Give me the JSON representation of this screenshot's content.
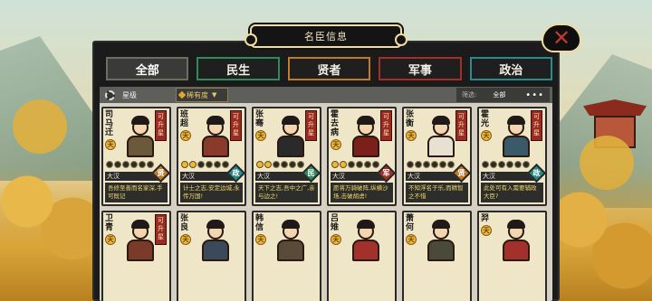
{
  "title": "名臣信息",
  "tabs": [
    "全部",
    "民生",
    "贤者",
    "军事",
    "政治"
  ],
  "filters": {
    "star_label": "星级",
    "rarity_label": "稀有度",
    "screen_label": "筛选:",
    "screen_value": "全部",
    "more": "•••"
  },
  "cards": [
    {
      "name": "司马迁",
      "grade": "天",
      "promo": "可升星",
      "faction": "大汉",
      "category": "贤",
      "category_color": "#c47a2c",
      "stars": 0,
      "desc": "吾修至善而名家深,手可既记",
      "robe": "#6a5a3a"
    },
    {
      "name": "班超",
      "grade": "天",
      "promo": "可升星",
      "faction": "大汉",
      "category": "政",
      "category_color": "#2a8c8a",
      "stars": 2,
      "desc": "计士之志,安定边城,永传万国!",
      "robe": "#8a3a2a"
    },
    {
      "name": "张骞",
      "grade": "天",
      "promo": "可升星",
      "faction": "大汉",
      "category": "民",
      "category_color": "#2f8a5c",
      "stars": 2,
      "desc": "天下之志,吾中之广,亲与边之!",
      "robe": "#2a2a2a"
    },
    {
      "name": "霍去病",
      "grade": "天",
      "promo": "可升星",
      "faction": "大汉",
      "category": "军",
      "category_color": "#a33028",
      "stars": 2,
      "desc": "愿将万骑破阵,纵横沙场,击破胡虏!",
      "robe": "#7a1f1a"
    },
    {
      "name": "张衡",
      "grade": "天",
      "promo": "可升星",
      "faction": "大汉",
      "category": "贤",
      "category_color": "#c47a2c",
      "stars": 0,
      "desc": "不知浮名于乐,而精智之不惜",
      "robe": "#e8e0d0"
    },
    {
      "name": "霍光",
      "grade": "天",
      "promo": "可升星",
      "faction": "大汉",
      "category": "政",
      "category_color": "#2a8c8a",
      "stars": 0,
      "desc": "此处可有入需要辅政大臣?",
      "robe": "#3a5a6a"
    },
    {
      "name": "卫青",
      "grade": "天",
      "promo": "可升星",
      "robe": "#7a3a2a"
    },
    {
      "name": "张良",
      "grade": "天",
      "promo": "",
      "robe": "#3a4a5a"
    },
    {
      "name": "韩信",
      "grade": "天",
      "promo": "",
      "robe": "#5a4a3a"
    },
    {
      "name": "吕雉",
      "grade": "天",
      "promo": "",
      "robe": "#a3302a"
    },
    {
      "name": "萧何",
      "grade": "天",
      "promo": "",
      "robe": "#4a4a3a"
    },
    {
      "name": "羿",
      "grade": "天",
      "promo": "",
      "robe": "#a3302a"
    }
  ]
}
